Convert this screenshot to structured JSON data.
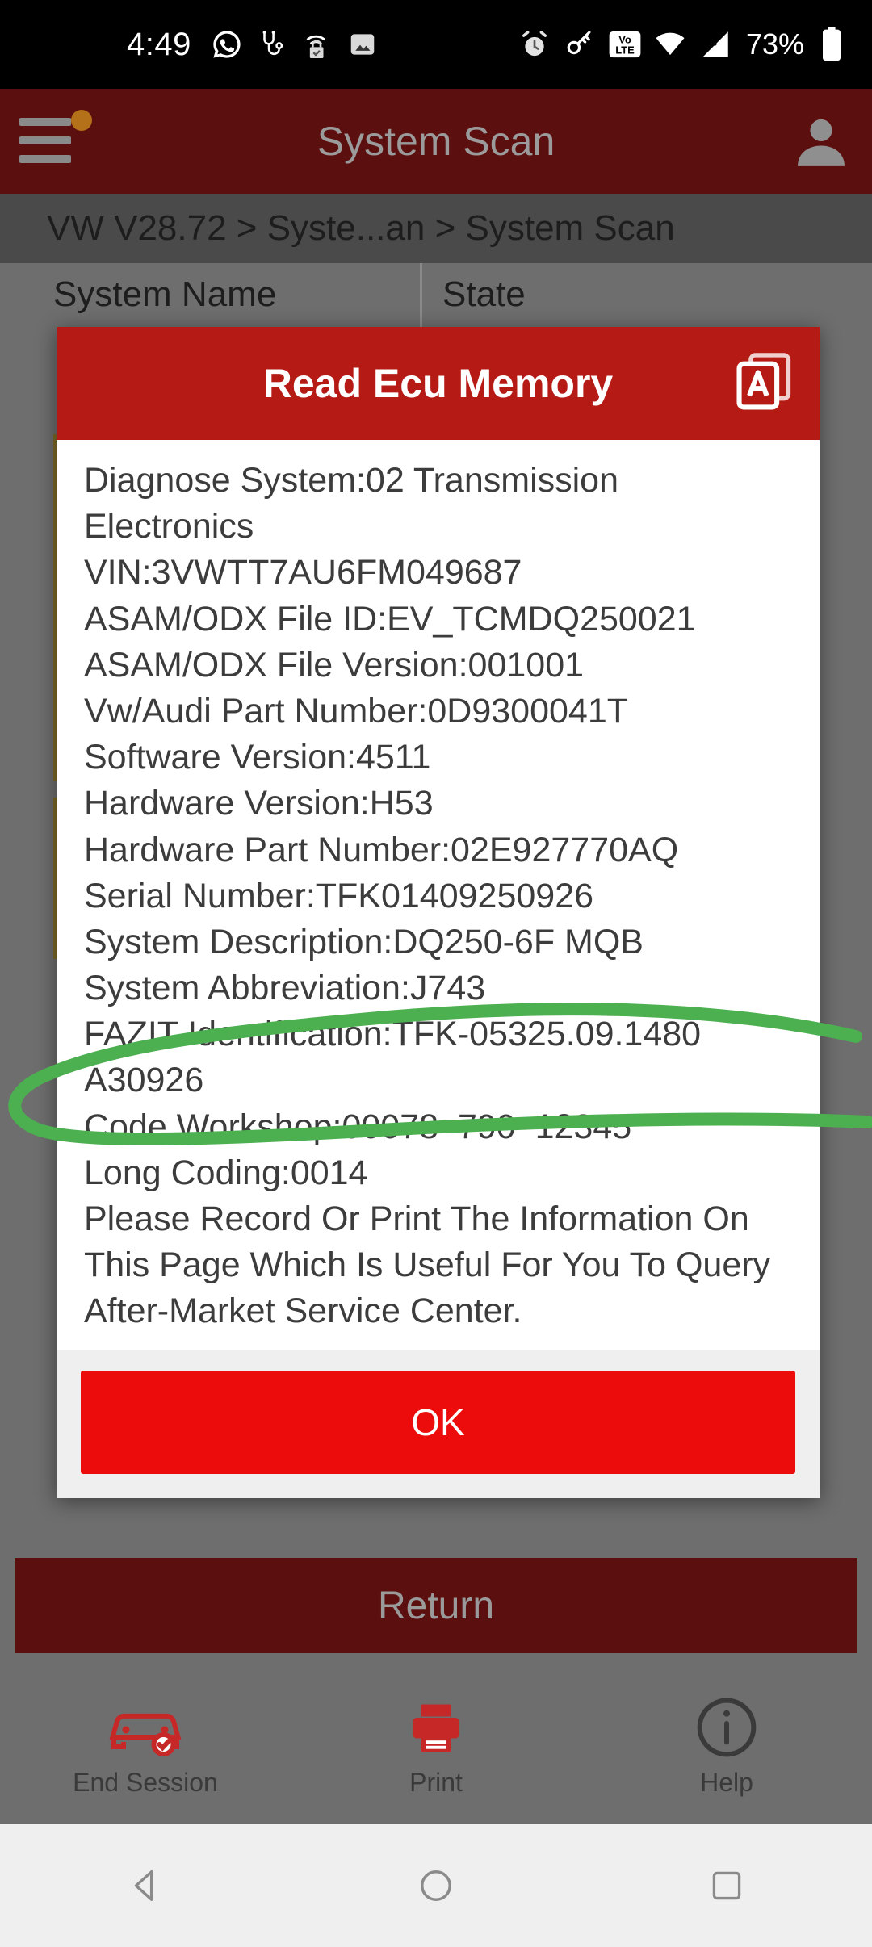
{
  "status_bar": {
    "time": "4:49",
    "battery_percent": "73%",
    "icons": [
      "whatsapp-icon",
      "stethoscope-icon",
      "secure-wifi-icon",
      "image-icon",
      "alarm-icon",
      "key-icon",
      "volte-icon",
      "wifi-icon",
      "signal-off-icon",
      "battery-icon"
    ]
  },
  "app_bar": {
    "title": "System Scan",
    "menu_icon": "hamburger-menu-icon",
    "badge": "notification-dot",
    "avatar_icon": "user-avatar-icon"
  },
  "breadcrumb": {
    "text": "VW V28.72 > Syste...an > System Scan"
  },
  "table": {
    "columns": [
      "System Name",
      "State"
    ]
  },
  "dialog": {
    "title": "Read Ecu Memory",
    "header_icon": "copy-text-icon",
    "lines": [
      "Diagnose System:02 Transmission Electronics",
      "VIN:3VWTT7AU6FM049687",
      "ASAM/ODX File ID:EV_TCMDQ250021",
      "ASAM/ODX File Version:001001",
      "Vw/Audi Part Number:0D9300041T",
      "Software Version:4511",
      "Hardware Version:H53",
      "Hardware Part Number:02E927770AQ",
      "Serial Number:TFK01409250926",
      "System Description:DQ250-6F MQB",
      "System Abbreviation:J743",
      "FAZIT Identification:TFK-05325.09.1480 A30926",
      "Code Workshop:00078  790  12345",
      "Long Coding:0014",
      "Please Record Or Print The Information On This Page Which Is Useful For You To Query After-Market Service Center."
    ],
    "ok_label": "OK"
  },
  "return_button": {
    "label": "Return"
  },
  "bottom_bar": {
    "items": [
      {
        "label": "End Session",
        "icon": "car-check-icon"
      },
      {
        "label": "Print",
        "icon": "printer-icon"
      },
      {
        "label": "Help",
        "icon": "info-icon"
      }
    ]
  },
  "nav_bar": {
    "back": "back-triangle-icon",
    "home": "home-circle-icon",
    "recents": "recents-square-icon"
  },
  "annotation": {
    "type": "hand-drawn-ellipse",
    "color": "#4caf50",
    "target_line": "FAZIT Identification:TFK-05325.09.1480 A30926"
  },
  "colors": {
    "app_bar": "#5c0f0f",
    "dialog_header": "#b51a15",
    "ok_button": "#ec0c0c",
    "background": "#6e6e6e",
    "annotation_green": "#4caf50"
  }
}
